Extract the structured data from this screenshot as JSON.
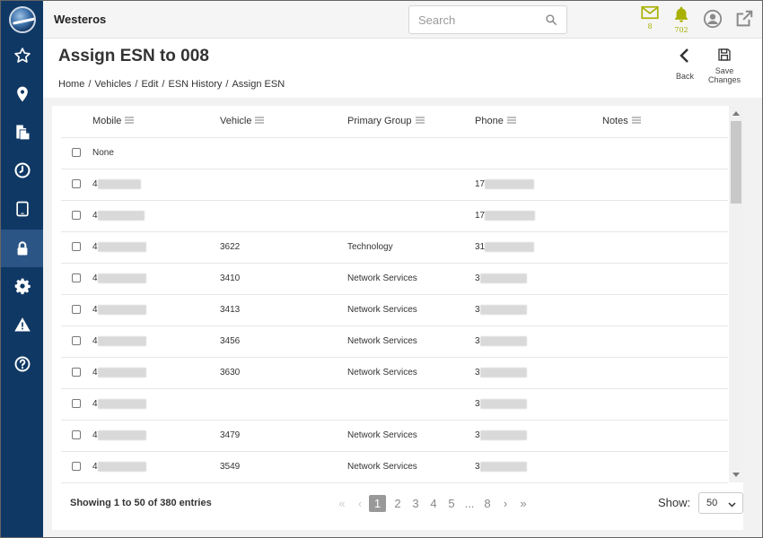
{
  "app": {
    "brand": "Westeros"
  },
  "search": {
    "placeholder": "Search"
  },
  "header_icons": {
    "messages_count": "8",
    "alerts_count": "702"
  },
  "page": {
    "title": "Assign ESN to 008",
    "breadcrumb": [
      "Home",
      "Vehicles",
      "Edit",
      "ESN History",
      "Assign ESN"
    ],
    "back_label": "Back",
    "save_label_line1": "Save",
    "save_label_line2": "Changes"
  },
  "table": {
    "columns": [
      "Mobile",
      "Vehicle",
      "Primary Group",
      "Phone",
      "Notes"
    ],
    "rows": [
      {
        "mobile": "None",
        "vehicle": "",
        "group": "",
        "phone": "",
        "notes": ""
      },
      {
        "mobile": "4",
        "vehicle": "",
        "group": "",
        "phone": "17",
        "notes": ""
      },
      {
        "mobile": "4",
        "vehicle": "",
        "group": "",
        "phone": "17",
        "notes": ""
      },
      {
        "mobile": "4",
        "vehicle": "3622",
        "group": "Technology",
        "phone": "31",
        "notes": ""
      },
      {
        "mobile": "4",
        "vehicle": "3410",
        "group": "Network Services",
        "phone": "3",
        "notes": ""
      },
      {
        "mobile": "4",
        "vehicle": "3413",
        "group": "Network Services",
        "phone": "3",
        "notes": ""
      },
      {
        "mobile": "4",
        "vehicle": "3456",
        "group": "Network Services",
        "phone": "3",
        "notes": ""
      },
      {
        "mobile": "4",
        "vehicle": "3630",
        "group": "Network Services",
        "phone": "3",
        "notes": ""
      },
      {
        "mobile": "4",
        "vehicle": "",
        "group": "",
        "phone": "3",
        "notes": ""
      },
      {
        "mobile": "4",
        "vehicle": "3479",
        "group": "Network Services",
        "phone": "3",
        "notes": ""
      },
      {
        "mobile": "4",
        "vehicle": "3549",
        "group": "Network Services",
        "phone": "3",
        "notes": ""
      }
    ]
  },
  "footer": {
    "entries_text": "Showing 1 to 50 of 380 entries",
    "pages": [
      "1",
      "2",
      "3",
      "4",
      "5",
      "...",
      "8"
    ],
    "current_page": "1",
    "show_label": "Show:",
    "page_size": "50"
  },
  "colors": {
    "sidebar": "#0f3864",
    "sidebar_active": "#2a5585",
    "accent": "#a8b000"
  }
}
